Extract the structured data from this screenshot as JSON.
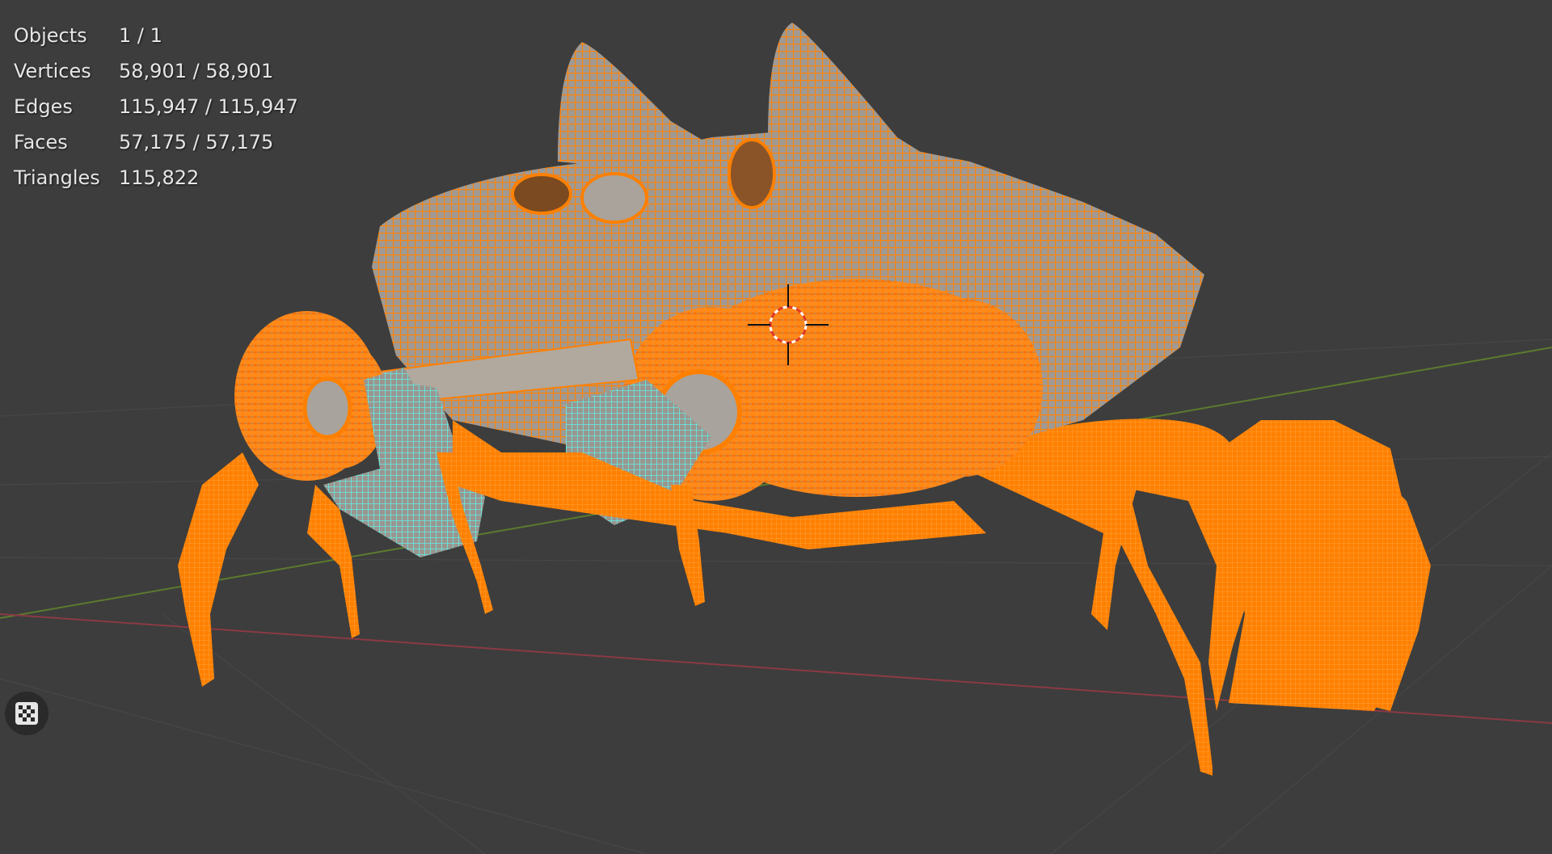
{
  "stats": [
    {
      "label": "Objects",
      "value": "1 / 1"
    },
    {
      "label": "Vertices",
      "value": "58,901 / 58,901"
    },
    {
      "label": "Edges",
      "value": "115,947 / 115,947"
    },
    {
      "label": "Faces",
      "value": "57,175 / 57,175"
    },
    {
      "label": "Triangles",
      "value": "115,822"
    }
  ],
  "colors": {
    "background": "#3d3d3d",
    "selection_orange": "#ff8000",
    "active_cyan": "#5ff0e6",
    "mesh_gray": "#a8a39d",
    "x_axis": "#8a3a44",
    "y_axis": "#5c7a2e"
  },
  "icons": {
    "shading_toggle": "checker-icon",
    "cursor": "3d-cursor-icon"
  }
}
